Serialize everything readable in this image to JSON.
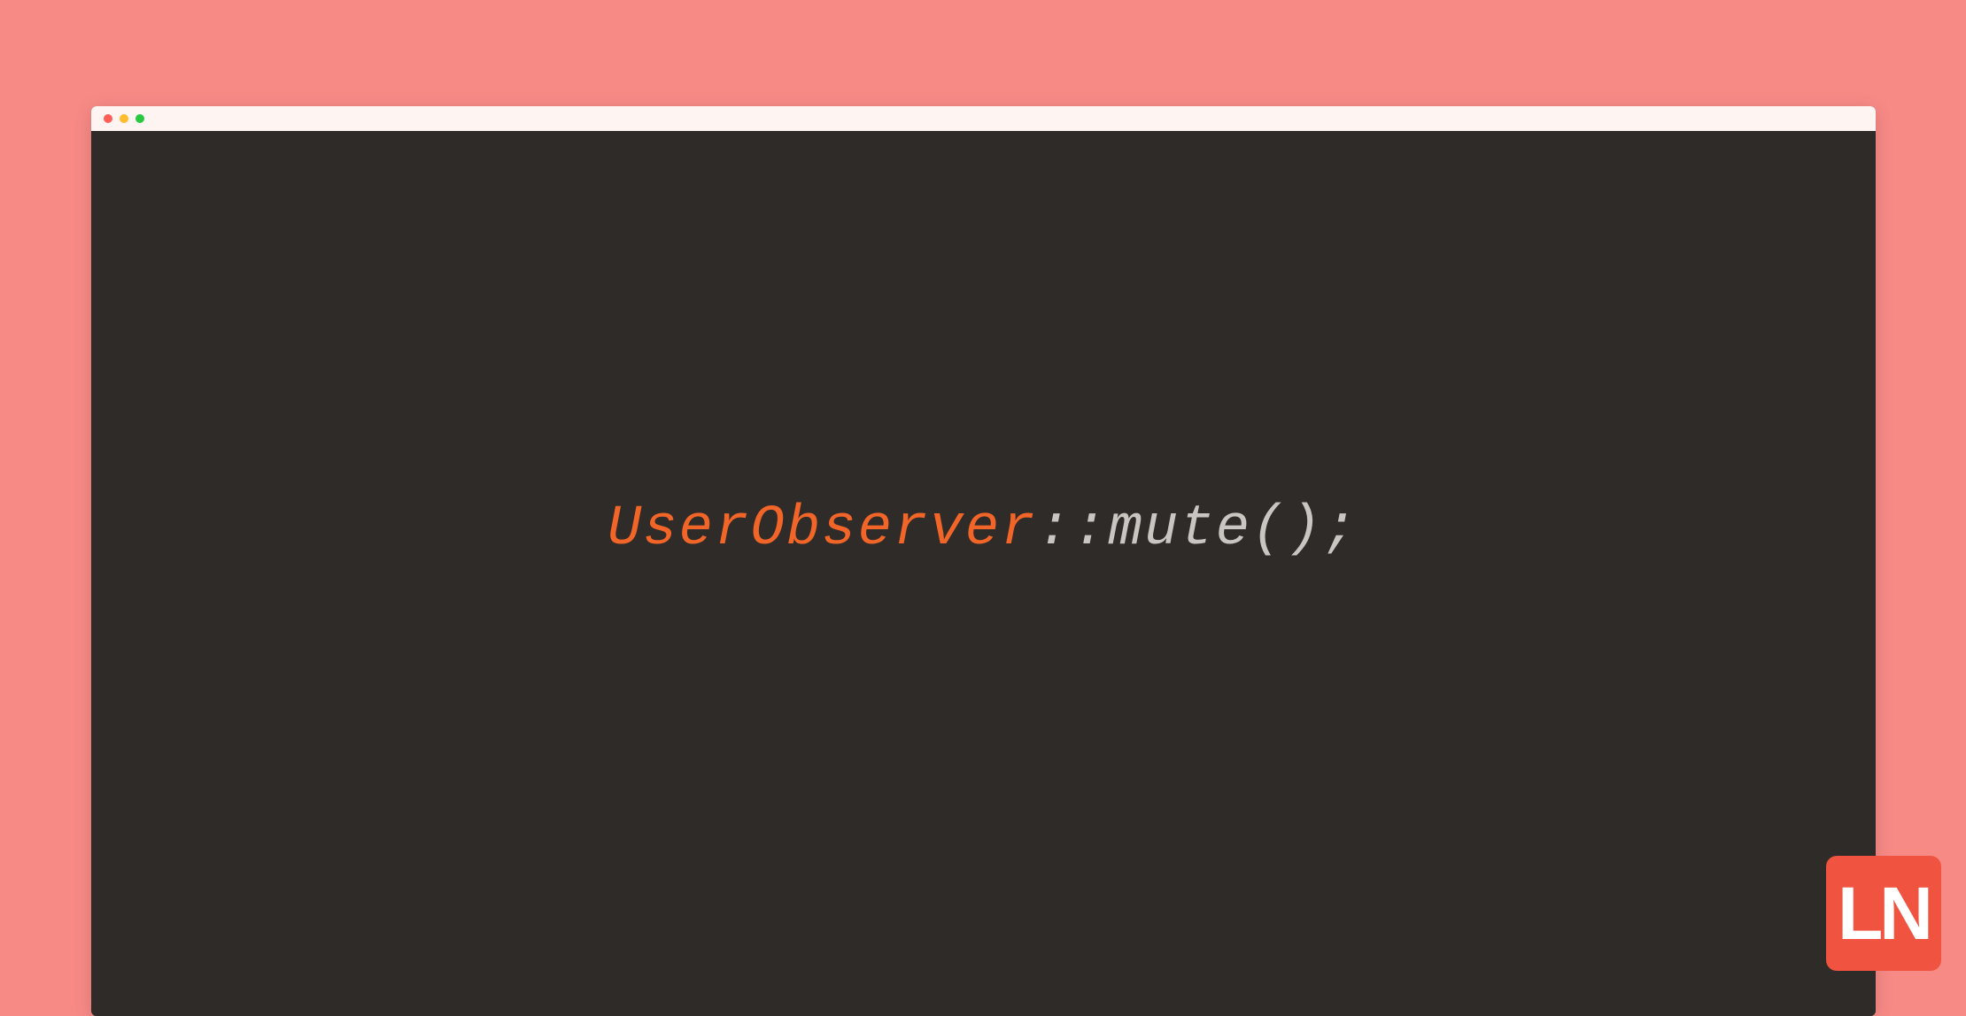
{
  "code": {
    "class_name": "UserObserver",
    "method_call": "::mute();"
  },
  "logo": {
    "text": "LN"
  },
  "colors": {
    "background": "#f88a86",
    "terminal_body": "#2e2b28",
    "title_bar": "#fef5f3",
    "code_class": "#f16528",
    "code_method": "#c9c5c0",
    "logo_bg": "#f05340",
    "logo_text": "#ffffff",
    "traffic_red": "#ff5f57",
    "traffic_yellow": "#febc2e",
    "traffic_green": "#28c840"
  }
}
